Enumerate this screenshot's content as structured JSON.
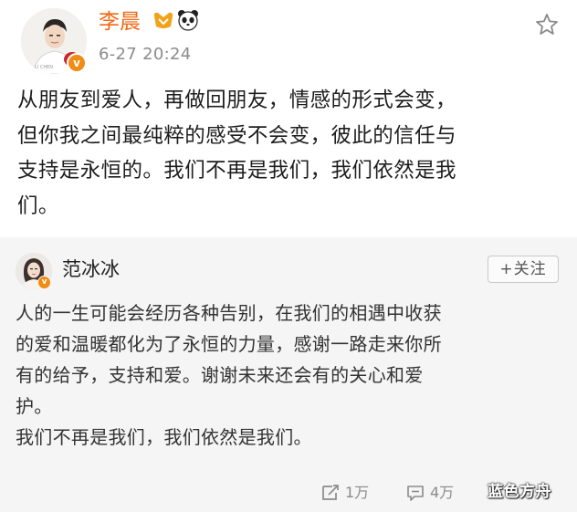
{
  "post": {
    "author": "李晨",
    "time": "6-27 20:24",
    "lines": [
      "从朋友到爱人，再做回朋友，情感的形式会变，",
      "但你我之间最纯粹的感受不会变，彼此的信任与",
      "支持是永恒的。我们不再是我们，我们依然是我",
      "们。"
    ],
    "icons": [
      "verified-v-icon",
      "vip-crown-icon",
      "panda-icon",
      "star-icon"
    ]
  },
  "repost": {
    "author": "范冰冰",
    "follow_label": "+关注",
    "lines": [
      "人的一生可能会经历各种告别，在我们的相遇中收获",
      "的爱和温暖都化为了永恒的力量，感谢一路走来你所",
      "有的给予，支持和爱。谢谢未来还会有的关心和爱",
      "护。",
      "我们不再是我们，我们依然是我们。"
    ],
    "repost_count": "1万",
    "comment_count": "4万",
    "icons": [
      "verified-v-icon",
      "repost-icon",
      "comment-icon"
    ]
  },
  "watermark": "蓝色方舟",
  "colors": {
    "author_name": "#f06a14",
    "verified_badge": "#f08b13",
    "repost_bg": "#f5f5f5",
    "meta_text": "#8b8b8b"
  }
}
